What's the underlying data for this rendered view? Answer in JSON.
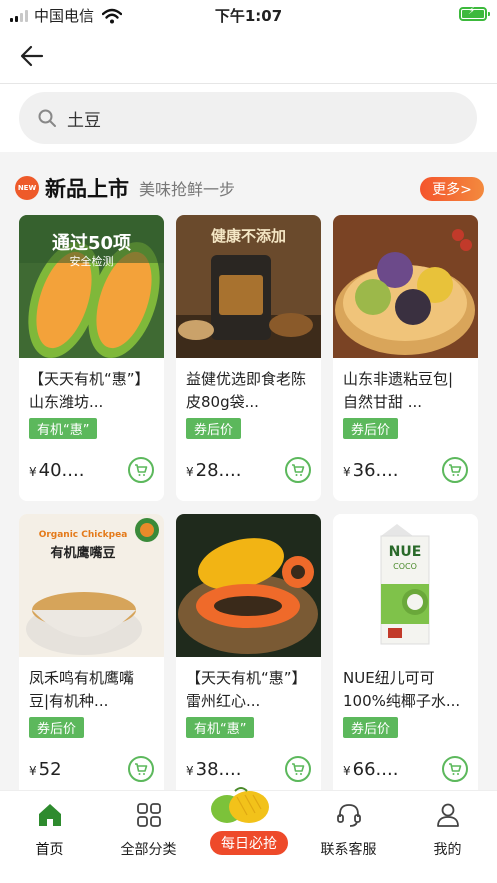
{
  "status": {
    "carrier": "中国电信",
    "time": "下午1:07",
    "battery_level": 1.0
  },
  "search": {
    "value": "土豆"
  },
  "section": {
    "badge": "NEW",
    "title": "新品上市",
    "subtitle": "美味抢鲜一步",
    "more": "更多>"
  },
  "products": [
    {
      "title": "【天天有机“惠”】山东潍坊...",
      "tag": "有机“惠”",
      "currency": "¥",
      "price": "40....",
      "image_text": "通过50项",
      "image_subtext": "安全检测"
    },
    {
      "title": "益健优选即食老陈皮80g袋...",
      "tag": "券后价",
      "currency": "¥",
      "price": "28....",
      "image_text": "健康不添加"
    },
    {
      "title": "山东非遗粘豆包|自然甘甜 ...",
      "tag": "券后价",
      "currency": "¥",
      "price": "36...."
    },
    {
      "title": "凤禾鸣有机鹰嘴豆|有机种...",
      "tag": "券后价",
      "currency": "¥",
      "price": "52",
      "image_text": "Organic Chickpea",
      "image_subtext": "有机鹰嘴豆"
    },
    {
      "title": "【天天有机“惠”】雷州红心...",
      "tag": "有机“惠”",
      "currency": "¥",
      "price": "38...."
    },
    {
      "title": "NUE纽儿可可100%纯椰子水...",
      "tag": "券后价",
      "currency": "¥",
      "price": "66....",
      "image_text": "NUE",
      "image_subtext": "COCO"
    }
  ],
  "tabbar": {
    "home": "首页",
    "categories": "全部分类",
    "daily": "每日必抢",
    "service": "联系客服",
    "mine": "我的"
  },
  "colors": {
    "accent": "#5cb85c",
    "more": "#f4542c",
    "daily": "#ee4a2a",
    "badge": "#ee5a2a"
  }
}
